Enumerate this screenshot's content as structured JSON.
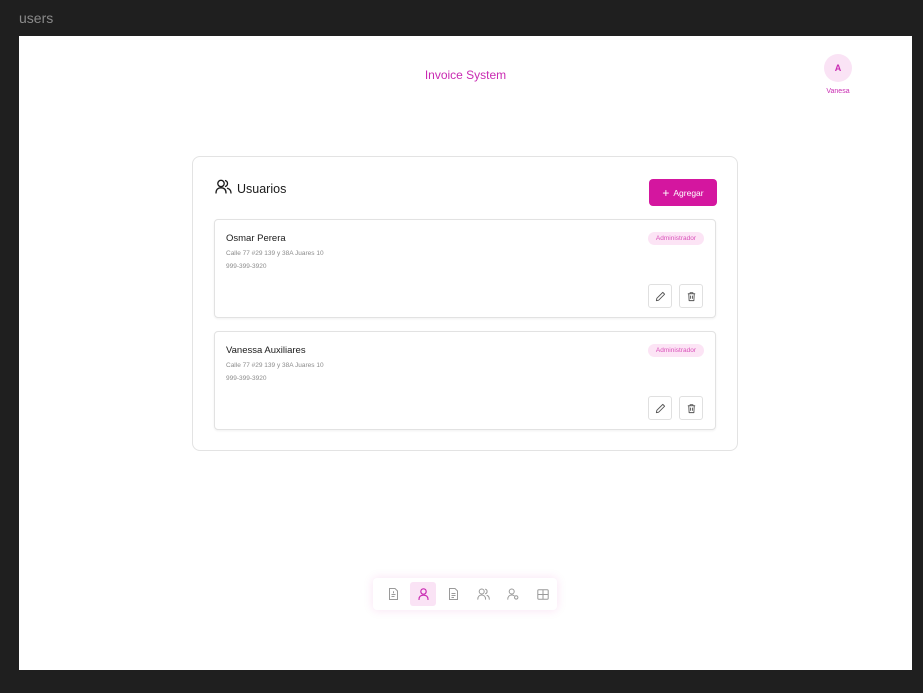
{
  "frame_label": "users",
  "header": {
    "title": "Invoice System",
    "avatar_initial": "A",
    "user_name": "Vanesa"
  },
  "panel": {
    "title": "Usuarios",
    "title_icon": "users-icon",
    "add_button_label": "Agregar"
  },
  "users": [
    {
      "name": "Osmar Perera",
      "address": "Calle 77 #29 139 y 38A Juares 10",
      "phone": "999-399-3920",
      "role": "Administrador"
    },
    {
      "name": "Vanessa Auxiliares",
      "address": "Calle 77 #29 139 y 38A Juares 10",
      "phone": "999-399-3920",
      "role": "Administrador"
    }
  ],
  "dock": {
    "items": [
      "invoice-icon",
      "user-icon",
      "document-icon",
      "users-icon",
      "user-settings-icon",
      "table-icon"
    ],
    "active_item": "user-icon"
  },
  "colors": {
    "accent": "#d4169f",
    "accent_light": "#fae3f5",
    "background": "#1f1f1f"
  }
}
